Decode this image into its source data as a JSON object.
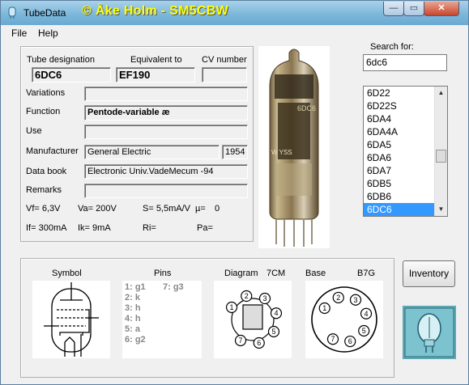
{
  "window": {
    "title": "TubeData",
    "credit": "© Åke Holm - SM5CBW",
    "controls": {
      "minimize": "—",
      "maximize": "▭",
      "close": "✕"
    }
  },
  "menu": [
    "File",
    "Help"
  ],
  "labels": {
    "tube_designation": "Tube designation",
    "equivalent_to": "Equivalent to",
    "cv_number": "CV number",
    "variations": "Variations",
    "function": "Function",
    "use": "Use",
    "manufacturer": "Manufacturer",
    "data_book": "Data book",
    "remarks": "Remarks",
    "search_for": "Search for:"
  },
  "values": {
    "tube_designation": "6DC6",
    "equivalent_to": "EF190",
    "cv_number": "",
    "variations": "",
    "function": "Pentode-variable æ",
    "use": "",
    "manufacturer": "General Electric",
    "year": "1954",
    "data_book": "Electronic Univ.VadeMecum -94",
    "remarks": ""
  },
  "params_row1": [
    "Vf= 6,3V",
    "Va= 200V",
    "S= 5,5mA/V",
    "µ=",
    "0"
  ],
  "params_row2": [
    "If= 300mA",
    "Ik= 9mA",
    "Ri=",
    "Pa="
  ],
  "search": {
    "value": "6dc6"
  },
  "list": {
    "items": [
      "6D22",
      "6D22S",
      "6DA4",
      "6DA4A",
      "6DA5",
      "6DA6",
      "6DA7",
      "6DB5",
      "6DB6",
      "6DC6"
    ],
    "selected": "6DC6",
    "scroll_position": 0.55
  },
  "bottom": {
    "symbol_label": "Symbol",
    "pins_label": "Pins",
    "diagram_label": "Diagram",
    "diagram_code": "7CM",
    "base_label": "Base",
    "base_code": "B7G",
    "pins_col1": [
      "1: g1",
      "2: k",
      "3: h",
      "4: h",
      "5: a",
      "6: g2"
    ],
    "pins_col2": [
      "7: g3"
    ],
    "pin_numbers": [
      "1",
      "2",
      "3",
      "4",
      "5",
      "6",
      "7"
    ]
  },
  "buttons": {
    "inventory": "Inventory"
  },
  "colors": {
    "title_credit": "#ffff00",
    "selection": "#3399ff"
  }
}
